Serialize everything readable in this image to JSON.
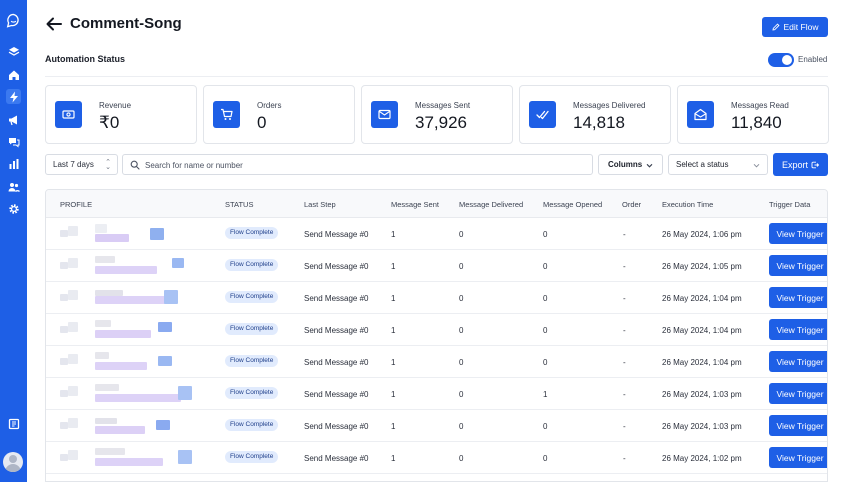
{
  "sidebar": {
    "items": [
      {
        "name": "logo",
        "icon": "chat-bubble-icon"
      },
      {
        "name": "layers",
        "icon": "layers-icon"
      },
      {
        "name": "home",
        "icon": "home-icon"
      },
      {
        "name": "automations",
        "icon": "bolt-icon",
        "active": true
      },
      {
        "name": "broadcast",
        "icon": "megaphone-icon"
      },
      {
        "name": "conversations",
        "icon": "chat-icon"
      },
      {
        "name": "analytics",
        "icon": "bar-chart-icon"
      },
      {
        "name": "contacts",
        "icon": "users-icon"
      },
      {
        "name": "settings",
        "icon": "gear-icon"
      },
      {
        "name": "docs",
        "icon": "book-icon"
      }
    ]
  },
  "header": {
    "title": "Comment-Song",
    "edit_label": "Edit Flow",
    "automation_status_label": "Automation Status",
    "toggle_label": "Enabled",
    "toggle_on": true
  },
  "stats": [
    {
      "label": "Revenue",
      "value": "₹0",
      "icon": "cash-icon"
    },
    {
      "label": "Orders",
      "value": "0",
      "icon": "cart-icon"
    },
    {
      "label": "Messages Sent",
      "value": "37,926",
      "icon": "mail-icon"
    },
    {
      "label": "Messages Delivered",
      "value": "14,818",
      "icon": "double-check-icon"
    },
    {
      "label": "Messages Read",
      "value": "11,840",
      "icon": "mail-open-icon"
    }
  ],
  "filters": {
    "date_range": "Last 7 days",
    "search_placeholder": "Search for name or number",
    "columns_label": "Columns",
    "status_placeholder": "Select a status",
    "export_label": "Export"
  },
  "table": {
    "headers": [
      "PROFILE",
      "STATUS",
      "Last Step",
      "Message Sent",
      "Message Delivered",
      "Message Opened",
      "Order",
      "Execution Time",
      "Trigger Data"
    ],
    "rows": [
      {
        "status": "Flow Complete",
        "last_step": "Send Message #0",
        "sent": "1",
        "delivered": "0",
        "opened": "0",
        "order": "-",
        "time": "26 May 2024, 1:06 pm",
        "action": "View Trigger"
      },
      {
        "status": "Flow Complete",
        "last_step": "Send Message #0",
        "sent": "1",
        "delivered": "0",
        "opened": "0",
        "order": "-",
        "time": "26 May 2024, 1:05 pm",
        "action": "View Trigger"
      },
      {
        "status": "Flow Complete",
        "last_step": "Send Message #0",
        "sent": "1",
        "delivered": "0",
        "opened": "0",
        "order": "-",
        "time": "26 May 2024, 1:04 pm",
        "action": "View Trigger"
      },
      {
        "status": "Flow Complete",
        "last_step": "Send Message #0",
        "sent": "1",
        "delivered": "0",
        "opened": "0",
        "order": "-",
        "time": "26 May 2024, 1:04 pm",
        "action": "View Trigger"
      },
      {
        "status": "Flow Complete",
        "last_step": "Send Message #0",
        "sent": "1",
        "delivered": "0",
        "opened": "0",
        "order": "-",
        "time": "26 May 2024, 1:04 pm",
        "action": "View Trigger"
      },
      {
        "status": "Flow Complete",
        "last_step": "Send Message #0",
        "sent": "1",
        "delivered": "0",
        "opened": "1",
        "order": "-",
        "time": "26 May 2024, 1:03 pm",
        "action": "View Trigger"
      },
      {
        "status": "Flow Complete",
        "last_step": "Send Message #0",
        "sent": "1",
        "delivered": "0",
        "opened": "0",
        "order": "-",
        "time": "26 May 2024, 1:03 pm",
        "action": "View Trigger"
      },
      {
        "status": "Flow Complete",
        "last_step": "Send Message #0",
        "sent": "1",
        "delivered": "0",
        "opened": "0",
        "order": "-",
        "time": "26 May 2024, 1:02 pm",
        "action": "View Trigger"
      }
    ]
  },
  "colors": {
    "accent": "#1e5fe6",
    "badge_bg": "#e1ebfd",
    "badge_text": "#1f3f8a"
  }
}
